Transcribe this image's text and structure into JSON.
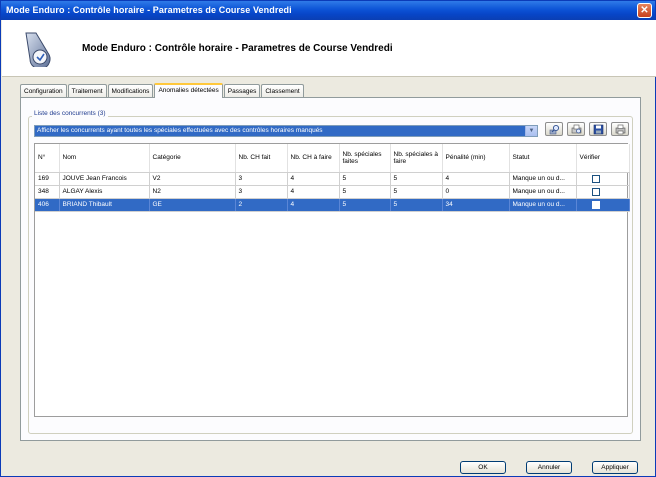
{
  "window": {
    "title": "Mode Enduro : Contrôle horaire - Parametres de Course Vendredi"
  },
  "header": {
    "title": "Mode Enduro : Contrôle horaire - Parametres de Course Vendredi"
  },
  "tabs": [
    {
      "label": "Configuration"
    },
    {
      "label": "Traitement"
    },
    {
      "label": "Modifications"
    },
    {
      "label": "Anomalies détectées"
    },
    {
      "label": "Passages"
    },
    {
      "label": "Classement"
    }
  ],
  "active_tab": "Anomalies détectées",
  "group": {
    "legend": "Liste des concurrents (3)"
  },
  "filter": {
    "selected": "Afficher les concurrents ayant toutes les spéciales effectuées avec des contrôles horaires manqués"
  },
  "toolbar_icons": [
    "search-icon",
    "print-preview-icon",
    "save-icon",
    "print-icon"
  ],
  "table": {
    "columns": [
      {
        "key": "num",
        "label": "N°"
      },
      {
        "key": "nom",
        "label": "Nom"
      },
      {
        "key": "cat",
        "label": "Catégorie"
      },
      {
        "key": "chfait",
        "label": "Nb. CH fait"
      },
      {
        "key": "chafaire",
        "label": "Nb. CH à faire"
      },
      {
        "key": "spfaites",
        "label": "Nb. spéciales faites"
      },
      {
        "key": "spafaire",
        "label": "Nb. spéciales à faire"
      },
      {
        "key": "penalite",
        "label": "Pénalité (min)"
      },
      {
        "key": "statut",
        "label": "Statut"
      },
      {
        "key": "verifier",
        "label": "Vérifier"
      }
    ],
    "rows": [
      {
        "num": "169",
        "nom": "JOUVE Jean Francois",
        "cat": "V2",
        "chfait": "3",
        "chafaire": "4",
        "spfaites": "5",
        "spafaire": "5",
        "penalite": "4",
        "statut": "Manque un ou d...",
        "verifier": false,
        "selected": false
      },
      {
        "num": "348",
        "nom": "ALGAY Alexis",
        "cat": "N2",
        "chfait": "3",
        "chafaire": "4",
        "spfaites": "5",
        "spafaire": "5",
        "penalite": "0",
        "statut": "Manque un ou d...",
        "verifier": false,
        "selected": false
      },
      {
        "num": "406",
        "nom": "BRIAND Thibault",
        "cat": "GE",
        "chfait": "2",
        "chafaire": "4",
        "spfaites": "5",
        "spafaire": "5",
        "penalite": "34",
        "statut": "Manque un ou d...",
        "verifier": false,
        "selected": true
      }
    ]
  },
  "buttons": {
    "ok": "OK",
    "cancel": "Annuler",
    "apply": "Appliquer"
  },
  "colors": {
    "titlebar": "#0c53d6",
    "selection": "#316ac5",
    "active_tab_accent": "#ffc83c"
  }
}
